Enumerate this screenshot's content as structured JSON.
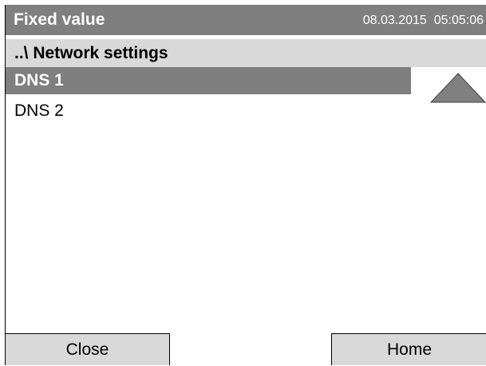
{
  "header": {
    "title": "Fixed value",
    "datetime": "08.03.2015  05:05:06"
  },
  "breadcrumb": {
    "text": "..\\ Network settings"
  },
  "list": {
    "items": [
      {
        "label": "DNS 1",
        "selected": true
      },
      {
        "label": "DNS 2",
        "selected": false
      }
    ]
  },
  "scroll": {
    "icon": "triangle-up-icon"
  },
  "buttons": {
    "close_label": "Close",
    "home_label": "Home"
  },
  "colors": {
    "title_bg": "#7f7f7f",
    "breadcrumb_bg": "#d9d9d9",
    "selected_bg": "#7f7f7f",
    "button_bg": "#d9d9d9",
    "arrow_fill": "#808080"
  }
}
